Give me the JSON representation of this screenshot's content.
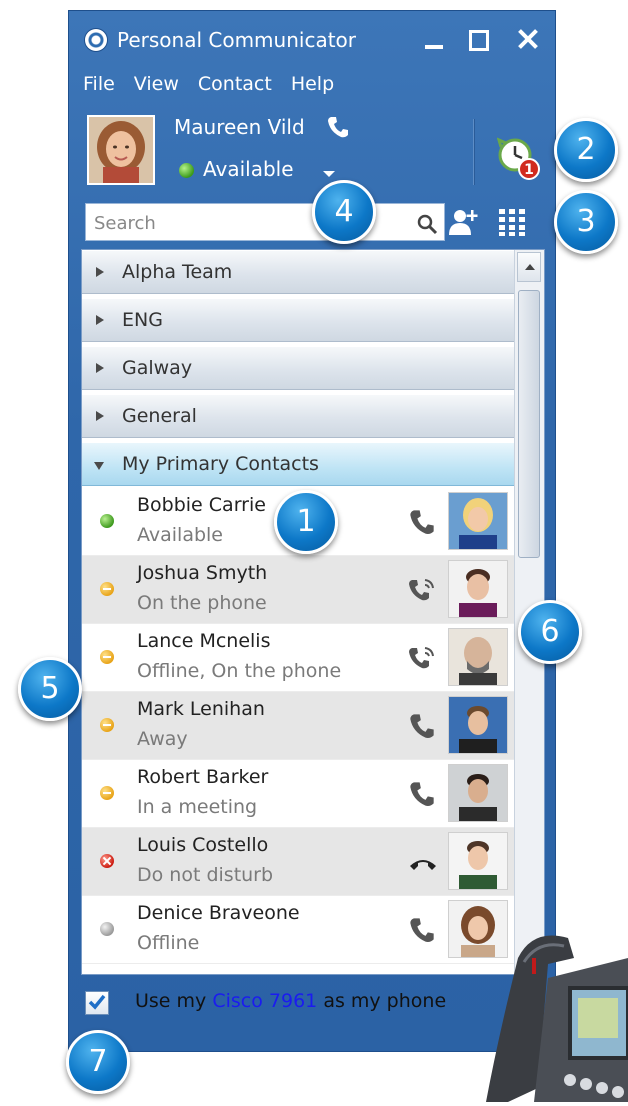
{
  "window": {
    "title": "Personal Communicator",
    "menu": [
      "File",
      "View",
      "Contact",
      "Help"
    ],
    "controls": {
      "minimize": "minimize",
      "maximize": "maximize",
      "close": "close"
    }
  },
  "user": {
    "name": "Maureen Vild",
    "status": "Available",
    "status_color": "#3f9a1f"
  },
  "search": {
    "placeholder": "Search"
  },
  "groups": [
    {
      "label": "Alpha Team",
      "expanded": false
    },
    {
      "label": "ENG",
      "expanded": false
    },
    {
      "label": "Galway",
      "expanded": false
    },
    {
      "label": "General",
      "expanded": false
    },
    {
      "label": "My Primary Contacts",
      "expanded": true
    }
  ],
  "contacts": [
    {
      "name": "Bobbie Carrie",
      "status": "Available",
      "presence": "available",
      "call": "phone-icon"
    },
    {
      "name": "Joshua Smyth",
      "status": "On the phone",
      "presence": "busy",
      "call": "ringing-phone-icon"
    },
    {
      "name": "Lance Mcnelis",
      "status": "Offline, On the phone",
      "presence": "busy",
      "call": "ringing-phone-icon"
    },
    {
      "name": "Mark Lenihan",
      "status": "Away",
      "presence": "busy",
      "call": "phone-icon"
    },
    {
      "name": "Robert Barker",
      "status": "In a meeting",
      "presence": "busy",
      "call": "phone-icon"
    },
    {
      "name": "Louis Costello",
      "status": "Do not disturb",
      "presence": "dnd",
      "call": "hangup-icon"
    },
    {
      "name": "Denice Braveone",
      "status": "Offline",
      "presence": "offline",
      "call": "phone-icon"
    }
  ],
  "footer": {
    "checked": true,
    "prefix": "Use my",
    "link": "Cisco 7961",
    "suffix": "as my phone"
  },
  "badges": {
    "recents_count": "1"
  },
  "callouts": [
    "1",
    "2",
    "3",
    "4",
    "5",
    "6",
    "7"
  ],
  "colors": {
    "window_blue": "#2f67aa",
    "callout_blue": "#0d78c8",
    "link_blue": "#1b1bf0",
    "available_green": "#3f9a1f",
    "busy_amber": "#e8a419",
    "dnd_red": "#cc1d12",
    "offline_grey": "#9a9a9a"
  }
}
